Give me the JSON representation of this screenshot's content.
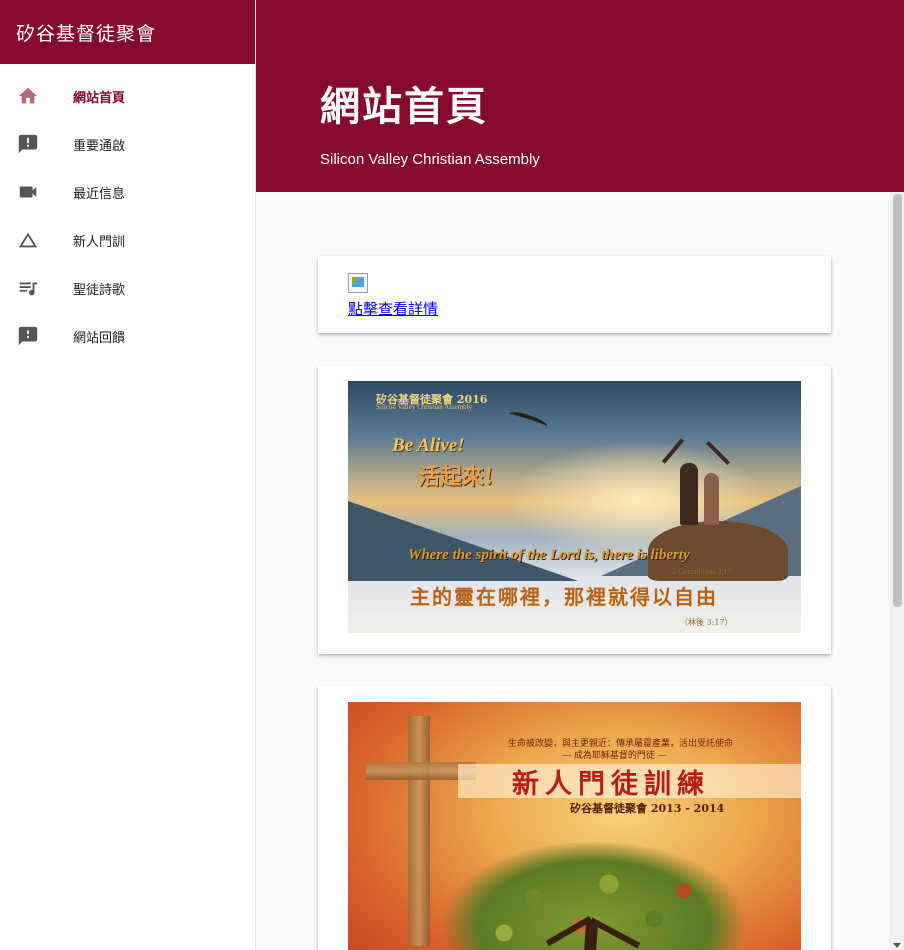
{
  "site": {
    "title": "矽谷基督徒聚會"
  },
  "sidebar": {
    "items": [
      {
        "label": "網站首頁",
        "icon": "home-icon",
        "active": true
      },
      {
        "label": "重要通啟",
        "icon": "announcement-icon",
        "active": false
      },
      {
        "label": "最近信息",
        "icon": "videocam-icon",
        "active": false
      },
      {
        "label": "新人門訓",
        "icon": "change-history-icon",
        "active": false
      },
      {
        "label": "聖徒詩歌",
        "icon": "queue-music-icon",
        "active": false
      },
      {
        "label": "網站回饋",
        "icon": "feedback-icon",
        "active": false
      }
    ]
  },
  "header": {
    "title": "網站首頁",
    "subtitle": "Silicon Valley Christian Assembly"
  },
  "cards": {
    "notice": {
      "link_text": "點擊查看詳情"
    },
    "banner1": {
      "top_line": "矽谷基督徒聚會 2016",
      "top_line_en": "Silicon Valley Christian Assembly",
      "heading_en": "Be Alive!",
      "heading_zh": "活起來!",
      "verse_en": "Where the spirit of the Lord is, there is liberty",
      "verse_ref": "2 Corinthians 3:17",
      "verse_zh": "主的靈在哪裡，那裡就得以自由",
      "verse_zh_ref": "（林後 3:17）"
    },
    "banner2": {
      "line1": "生命被改變，與主更親近：傳承屬靈產業，活出受託使命",
      "line2": "— 成為耶穌基督的門徒 —",
      "title": "新人門徒訓練",
      "subtitle": "矽谷基督徒聚會 2013 - 2014"
    }
  },
  "colors": {
    "brand": "#850a2e",
    "active_text": "#850a2e",
    "link": "#0000ee"
  }
}
